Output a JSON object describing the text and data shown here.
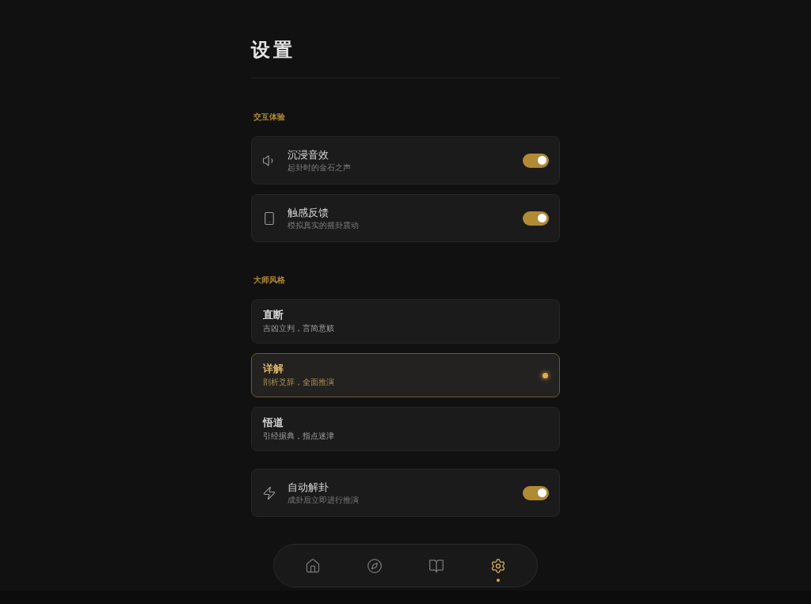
{
  "title": "设置",
  "sections": [
    {
      "title": "交互体验",
      "items": [
        {
          "kind": "toggle",
          "label": "沉浸音效",
          "description": "起卦时的金石之声",
          "on": true
        },
        {
          "kind": "toggle",
          "label": "触感反馈",
          "description": "模拟真实的摇卦震动",
          "on": true
        }
      ]
    },
    {
      "title": "大师风格",
      "items": [
        {
          "kind": "option",
          "label": "直断",
          "description": "吉凶立判，言简意赅",
          "selected": false
        },
        {
          "kind": "option",
          "label": "详解",
          "description": "剖析爻辞，全面推演",
          "selected": true
        },
        {
          "kind": "option",
          "label": "悟道",
          "description": "引经据典，指点迷津",
          "selected": false
        },
        {
          "kind": "toggle",
          "label": "自动解卦",
          "description": "成卦后立即进行推演",
          "on": true
        }
      ]
    }
  ],
  "nav": [
    {
      "selected": false
    },
    {
      "selected": false
    },
    {
      "selected": false
    },
    {
      "selected": true
    }
  ]
}
